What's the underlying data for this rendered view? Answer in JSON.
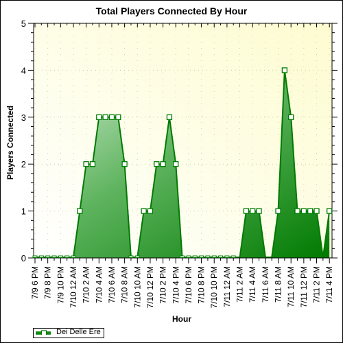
{
  "chart_data": {
    "type": "area",
    "title": "Total Players Connected By Hour",
    "xlabel": "Hour",
    "ylabel": "Players Connected",
    "ylim": [
      0,
      5
    ],
    "yticks": [
      0,
      1,
      2,
      3,
      4,
      5
    ],
    "grid": true,
    "legend_position": "bottom-left",
    "x_tick_labels": [
      "7/9 6 PM",
      "7/9 8 PM",
      "7/9 10 PM",
      "7/10 12 AM",
      "7/10 2 AM",
      "7/10 4 AM",
      "7/10 6 AM",
      "7/10 8 AM",
      "7/10 10 AM",
      "7/10 12 PM",
      "7/10 2 PM",
      "7/10 4 PM",
      "7/10 6 PM",
      "7/10 8 PM",
      "7/10 10 PM",
      "7/11 12 AM",
      "7/11 2 AM",
      "7/11 4 AM",
      "7/11 6 AM",
      "7/11 8 AM",
      "7/11 10 AM",
      "7/11 12 PM",
      "7/11 2 PM",
      "7/11 4 PM"
    ],
    "x_interval": "1 hour",
    "series": [
      {
        "name": "Dei Delle Ere",
        "color": "#008000",
        "values": [
          0,
          0,
          0,
          0,
          0,
          0,
          0,
          1,
          2,
          2,
          3,
          3,
          3,
          3,
          2,
          0,
          0,
          1,
          1,
          2,
          2,
          3,
          2,
          0,
          0,
          0,
          0,
          0,
          0,
          0,
          0,
          0,
          0,
          1,
          1,
          1,
          0,
          0,
          1,
          4,
          3,
          1,
          1,
          1,
          1,
          0,
          1
        ]
      }
    ]
  },
  "colors": {
    "plot_bg_light": "#ffffff",
    "plot_bg_tint": "#fdfcd8",
    "line": "#007a00",
    "fill_light": "#c8e6c8",
    "fill_dark": "#008000"
  }
}
